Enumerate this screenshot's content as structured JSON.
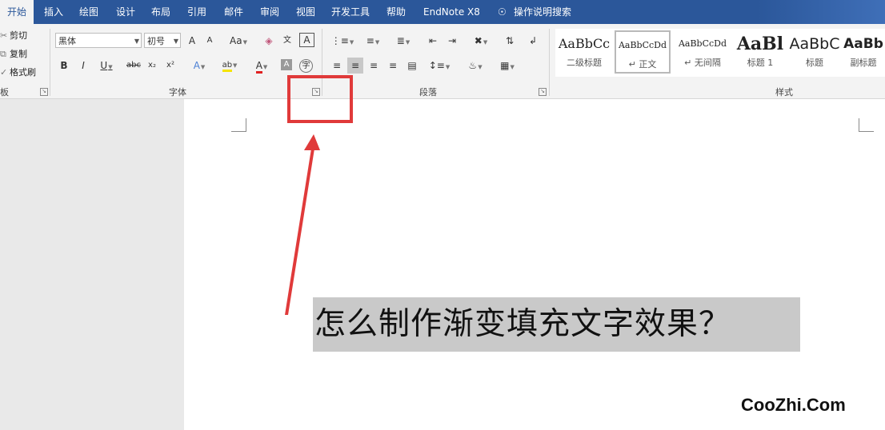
{
  "tabs": [
    "开始",
    "插入",
    "绘图",
    "设计",
    "布局",
    "引用",
    "邮件",
    "审阅",
    "视图",
    "开发工具",
    "帮助",
    "EndNote X8",
    "操作说明搜索"
  ],
  "clipboard": {
    "cut": "剪切",
    "copy": "复制",
    "format_painter": "格式刷",
    "group_label": "板"
  },
  "font": {
    "family": "黑体",
    "size": "初号",
    "group_label": "字体",
    "grow": "A",
    "shrink": "A",
    "change_case": "Aa",
    "bold": "B",
    "italic": "I",
    "underline": "U",
    "strike": "abc",
    "subscript": "x₂",
    "superscript": "x²",
    "text_effects": "A",
    "highlight": "ab",
    "font_color": "A",
    "shading": "A",
    "phonetic": "文",
    "border": "A",
    "enclose": "字"
  },
  "paragraph": {
    "group_label": "段落"
  },
  "styles": {
    "group_label": "样式",
    "items": [
      {
        "preview": "AaBbCc",
        "name": "二级标题"
      },
      {
        "preview": "AaBbCcDd",
        "name": "↵ 正文"
      },
      {
        "preview": "AaBbCcDd",
        "name": "↵ 无间隔"
      },
      {
        "preview": "AaBl",
        "name": "标题 1"
      },
      {
        "preview": "AaBbC",
        "name": "标题"
      },
      {
        "preview": "AaBb",
        "name": "副标题"
      }
    ]
  },
  "document": {
    "title": "怎么制作渐变填充文字效果？"
  },
  "watermark": "CooZhi.Com",
  "colors": {
    "ribbon_blue": "#2b579a",
    "highlight_red": "#e03a3a",
    "title_box": "#c9c9c9"
  }
}
